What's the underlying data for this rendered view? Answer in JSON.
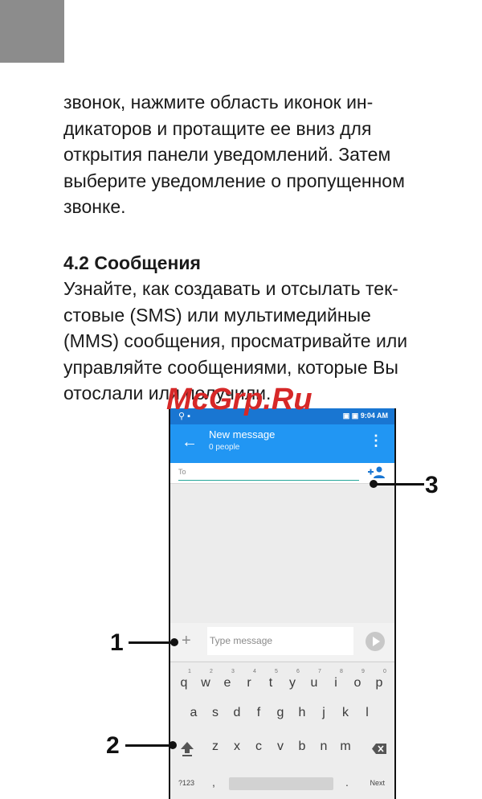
{
  "page": {
    "paragraph1": "звонок, нажмите область иконок индикаторов и протащите ее вниз для открытия панели уведомлений. Затем выберите уведомление о пропущенном звонке.",
    "paragraph1_lines": [
      "звонок, нажмите область иконок ин-",
      "дикаторов и протащите ее вниз для",
      "открытия панели уведомлений. Затем",
      "выберите уведомление о пропущенном",
      "звонке."
    ],
    "heading": "4.2 Сообщения",
    "paragraph2_lines": [
      "Узнайте, как создавать и отсылать тек-",
      "стовые (SMS) или мультимедийные",
      "(MMS) сообщения, просматривайте или",
      "управляйте сообщениями, которые Вы",
      "отослали или получили."
    ],
    "watermark": "McGrp.Ru"
  },
  "phone": {
    "status_time": "9:04",
    "status_ampm": "AM",
    "title": "New message",
    "subtitle": "0 people",
    "to_placeholder": "To",
    "message_placeholder": "Type message",
    "keyboard": {
      "row1": [
        "q",
        "w",
        "e",
        "r",
        "t",
        "y",
        "u",
        "i",
        "o",
        "p"
      ],
      "row1_hints": [
        "1",
        "2",
        "3",
        "4",
        "5",
        "6",
        "7",
        "8",
        "9",
        "0"
      ],
      "row2": [
        "a",
        "s",
        "d",
        "f",
        "g",
        "h",
        "j",
        "k",
        "l"
      ],
      "row3": [
        "z",
        "x",
        "c",
        "v",
        "b",
        "n",
        "m"
      ],
      "symbols_key": "?123",
      "comma": ",",
      "period": ".",
      "action_key": "Next"
    },
    "accent_color": "#2196f3"
  },
  "callouts": [
    "1",
    "2",
    "3"
  ]
}
